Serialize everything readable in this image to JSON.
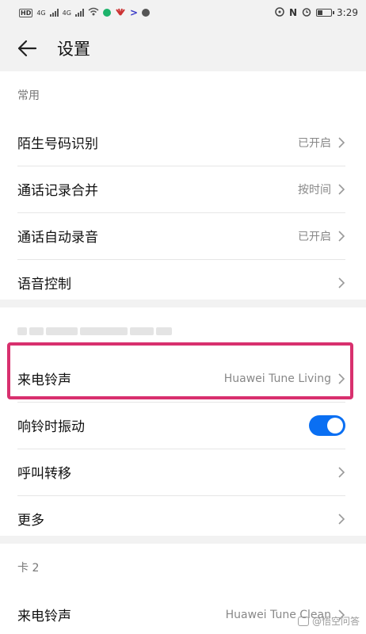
{
  "status_bar": {
    "carrier_1": "4G",
    "carrier_2": "4G",
    "time": "3:29"
  },
  "header": {
    "title": "设置"
  },
  "section_common": {
    "label": "常用",
    "items": [
      {
        "label": "陌生号码识别",
        "value": "已开启"
      },
      {
        "label": "通话记录合并",
        "value": "按时间"
      },
      {
        "label": "通话自动录音",
        "value": "已开启"
      },
      {
        "label": "语音控制",
        "value": ""
      }
    ]
  },
  "section_card1": {
    "items": [
      {
        "label": "来电铃声",
        "value": "Huawei Tune Living"
      },
      {
        "label": "响铃时振动",
        "toggle_on": true
      },
      {
        "label": "呼叫转移",
        "value": ""
      },
      {
        "label": "更多",
        "value": ""
      }
    ]
  },
  "section_card2": {
    "label": "卡 2",
    "items": [
      {
        "label": "来电铃声",
        "value": "Huawei Tune Clean"
      }
    ]
  },
  "watermark": {
    "text": "@悟空问答"
  },
  "colors": {
    "accent": "#0a6ff2",
    "highlight_border": "#d8306e"
  }
}
